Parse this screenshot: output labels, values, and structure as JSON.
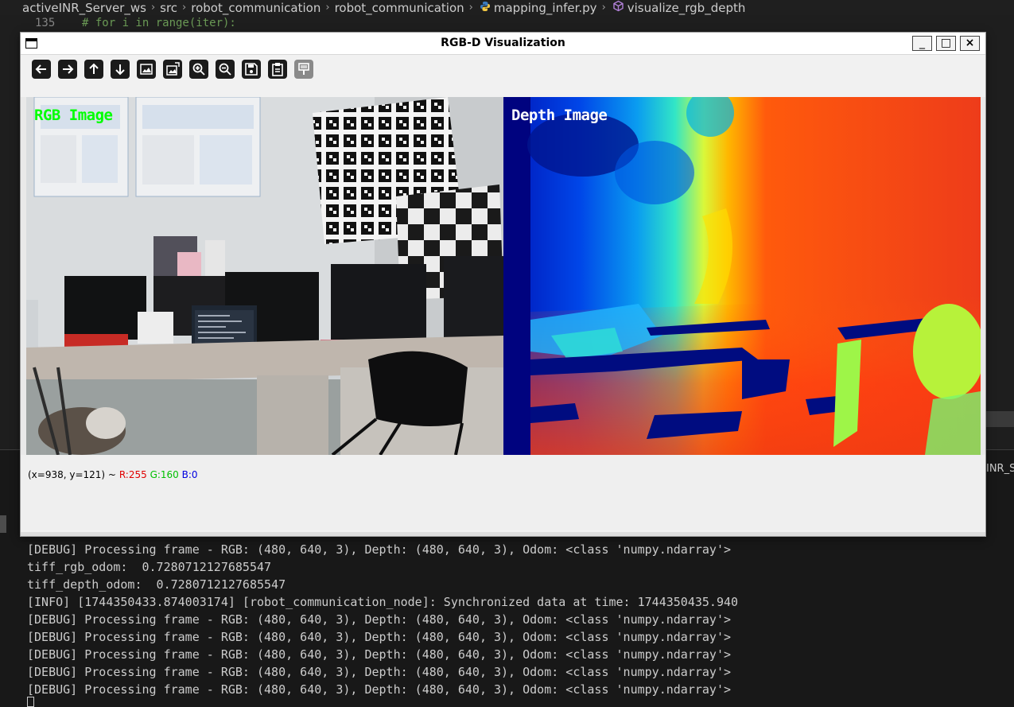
{
  "breadcrumb": {
    "items": [
      "activeINR_Server_ws",
      "src",
      "robot_communication",
      "robot_communication",
      "mapping_infer.py",
      "visualize_rgb_depth"
    ],
    "separator": "›",
    "python_icon": "python-file-icon",
    "symbol_icon": "method-cube-icon"
  },
  "editor": {
    "line_number": "135",
    "line_code": "#     for i in range(iter):"
  },
  "right_clip_text": "INR_Ser",
  "window": {
    "title": "RGB-D Visualization",
    "min_label": "_",
    "max_label": "□",
    "close_label": "×"
  },
  "toolbar": {
    "buttons": [
      {
        "name": "pan-left",
        "icon": "arrow-left-icon",
        "glyph": "←"
      },
      {
        "name": "pan-right",
        "icon": "arrow-right-icon",
        "glyph": "→"
      },
      {
        "name": "pan-up",
        "icon": "arrow-up-icon",
        "glyph": "↑"
      },
      {
        "name": "pan-down",
        "icon": "arrow-down-icon",
        "glyph": "↓"
      },
      {
        "name": "zoom-original",
        "icon": "image-icon",
        "glyph": ""
      },
      {
        "name": "zoom-fit",
        "icon": "image-fit-icon",
        "glyph": ""
      },
      {
        "name": "zoom-in",
        "icon": "zoom-in-icon",
        "glyph": ""
      },
      {
        "name": "zoom-out",
        "icon": "zoom-out-icon",
        "glyph": ""
      },
      {
        "name": "save",
        "icon": "save-icon",
        "glyph": ""
      },
      {
        "name": "copy-clipboard",
        "icon": "clipboard-icon",
        "glyph": ""
      },
      {
        "name": "properties",
        "icon": "properties-icon",
        "glyph": ""
      }
    ]
  },
  "images": {
    "rgb_label": "RGB Image",
    "depth_label": "Depth Image"
  },
  "status": {
    "coords": "(x=938, y=121) ~",
    "r": "R:255",
    "g": "G:160",
    "b": "B:0"
  },
  "terminal": {
    "lines": [
      "[DEBUG] Processing frame - RGB: (480, 640, 3), Depth: (480, 640, 3), Odom: <class 'numpy.ndarray'>",
      "tiff_rgb_odom:  0.7280712127685547",
      "tiff_depth_odom:  0.7280712127685547",
      "[INFO] [1744350433.874003174] [robot_communication_node]: Synchronized data at time: 1744350435.940",
      "[DEBUG] Processing frame - RGB: (480, 640, 3), Depth: (480, 640, 3), Odom: <class 'numpy.ndarray'>",
      "[DEBUG] Processing frame - RGB: (480, 640, 3), Depth: (480, 640, 3), Odom: <class 'numpy.ndarray'>",
      "[DEBUG] Processing frame - RGB: (480, 640, 3), Depth: (480, 640, 3), Odom: <class 'numpy.ndarray'>",
      "[DEBUG] Processing frame - RGB: (480, 640, 3), Depth: (480, 640, 3), Odom: <class 'numpy.ndarray'>",
      "[DEBUG] Processing frame - RGB: (480, 640, 3), Depth: (480, 640, 3), Odom: <class 'numpy.ndarray'>"
    ]
  }
}
